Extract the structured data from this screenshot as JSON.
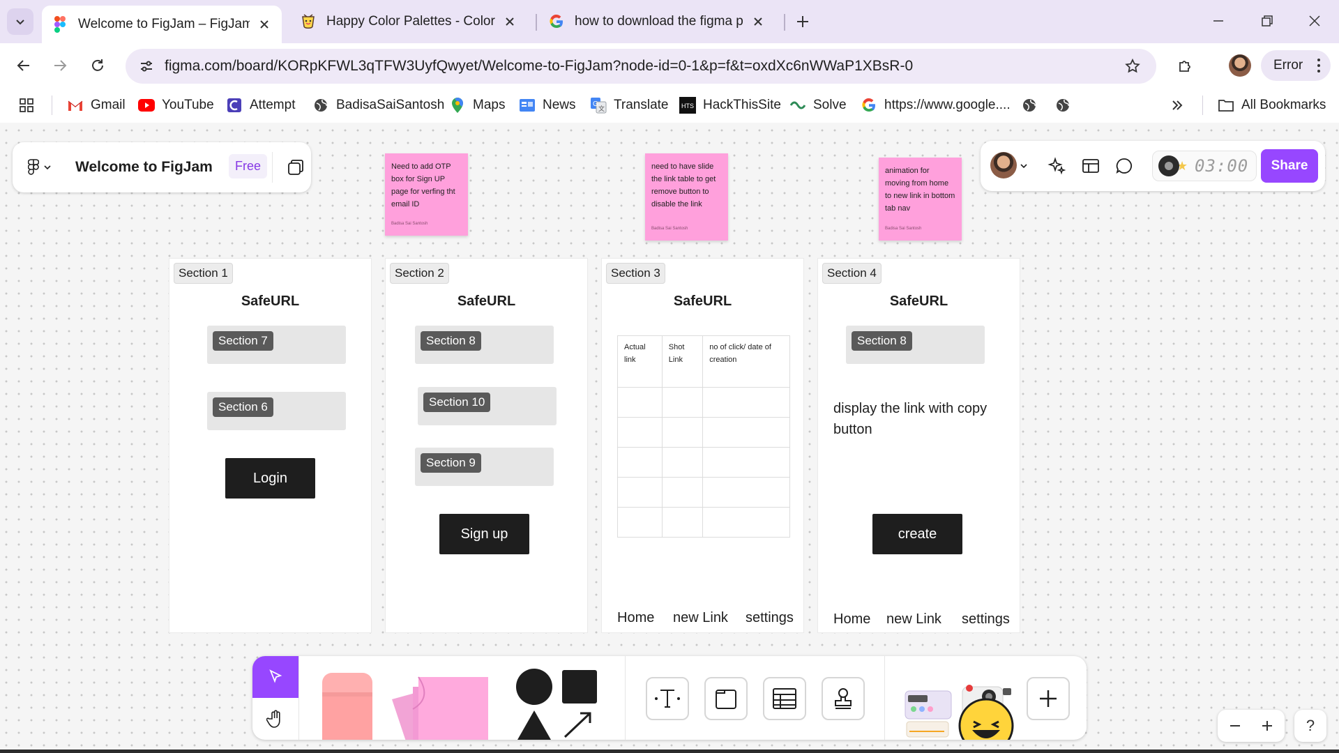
{
  "browser": {
    "tabs": [
      {
        "title": "Welcome to FigJam – FigJam",
        "active": true,
        "favicon": "figma-icon"
      },
      {
        "title": "Happy Color Palettes - Color Hunt",
        "active": false,
        "favicon": "colorhunt-icon"
      },
      {
        "title": "how to download the figma page",
        "active": false,
        "favicon": "google-icon"
      }
    ],
    "url": "figma.com/board/KORpKFWL3qTFW3UyfQwyet/Welcome-to-FigJam?node-id=0-1&p=f&t=oxdXc6nWWaP1XBsR-0",
    "profile_status": "Error",
    "bookmarks": [
      {
        "label": "Gmail",
        "icon": "gmail-icon"
      },
      {
        "label": "YouTube",
        "icon": "youtube-icon"
      },
      {
        "label": "Attempt",
        "icon": "attempt-icon"
      },
      {
        "label": "BadisaSaiSantosh",
        "icon": "globe-icon"
      },
      {
        "label": "Maps",
        "icon": "maps-icon"
      },
      {
        "label": "News",
        "icon": "news-icon"
      },
      {
        "label": "Translate",
        "icon": "translate-icon"
      },
      {
        "label": "HackThisSite",
        "icon": "hackthissite-icon"
      },
      {
        "label": "Solve",
        "icon": "solve-icon"
      },
      {
        "label": "https://www.google....",
        "icon": "google-icon"
      }
    ],
    "all_bookmarks": "All Bookmarks"
  },
  "figjam": {
    "file_name": "Welcome to FigJam",
    "plan": "Free",
    "timer": "03:00",
    "share_label": "Share",
    "accent": "#9747ff",
    "stickies": [
      {
        "text": "Need to add OTP box for Sign UP page for verfing tht email ID",
        "author": "Badisa Sai Santosh"
      },
      {
        "text": "need to have slide the link table to get remove button to disable the link",
        "author": "Badisa Sai Santosh"
      },
      {
        "text": "animation for moving from home to new link in bottom tab nav",
        "author": "Badisa Sai Santosh"
      }
    ],
    "sections": [
      {
        "label": "Section 1",
        "title": "SafeURL",
        "blocks": [
          "Section 7",
          "Section 6"
        ],
        "button": "Login"
      },
      {
        "label": "Section 2",
        "title": "SafeURL",
        "blocks": [
          "Section 8",
          "Section 10",
          "Section 9"
        ],
        "button": "Sign up"
      },
      {
        "label": "Section 3",
        "title": "SafeURL",
        "table_headers": [
          "Actual link",
          "Shot Link",
          "no of click/ date of creation"
        ],
        "nav": [
          "Home",
          "new Link",
          "settings"
        ]
      },
      {
        "label": "Section 4",
        "title": "SafeURL",
        "blocks": [
          "Section 8"
        ],
        "description": "display the link with copy button",
        "button": "create",
        "nav": [
          "Home",
          "new Link",
          "settings"
        ]
      }
    ]
  }
}
